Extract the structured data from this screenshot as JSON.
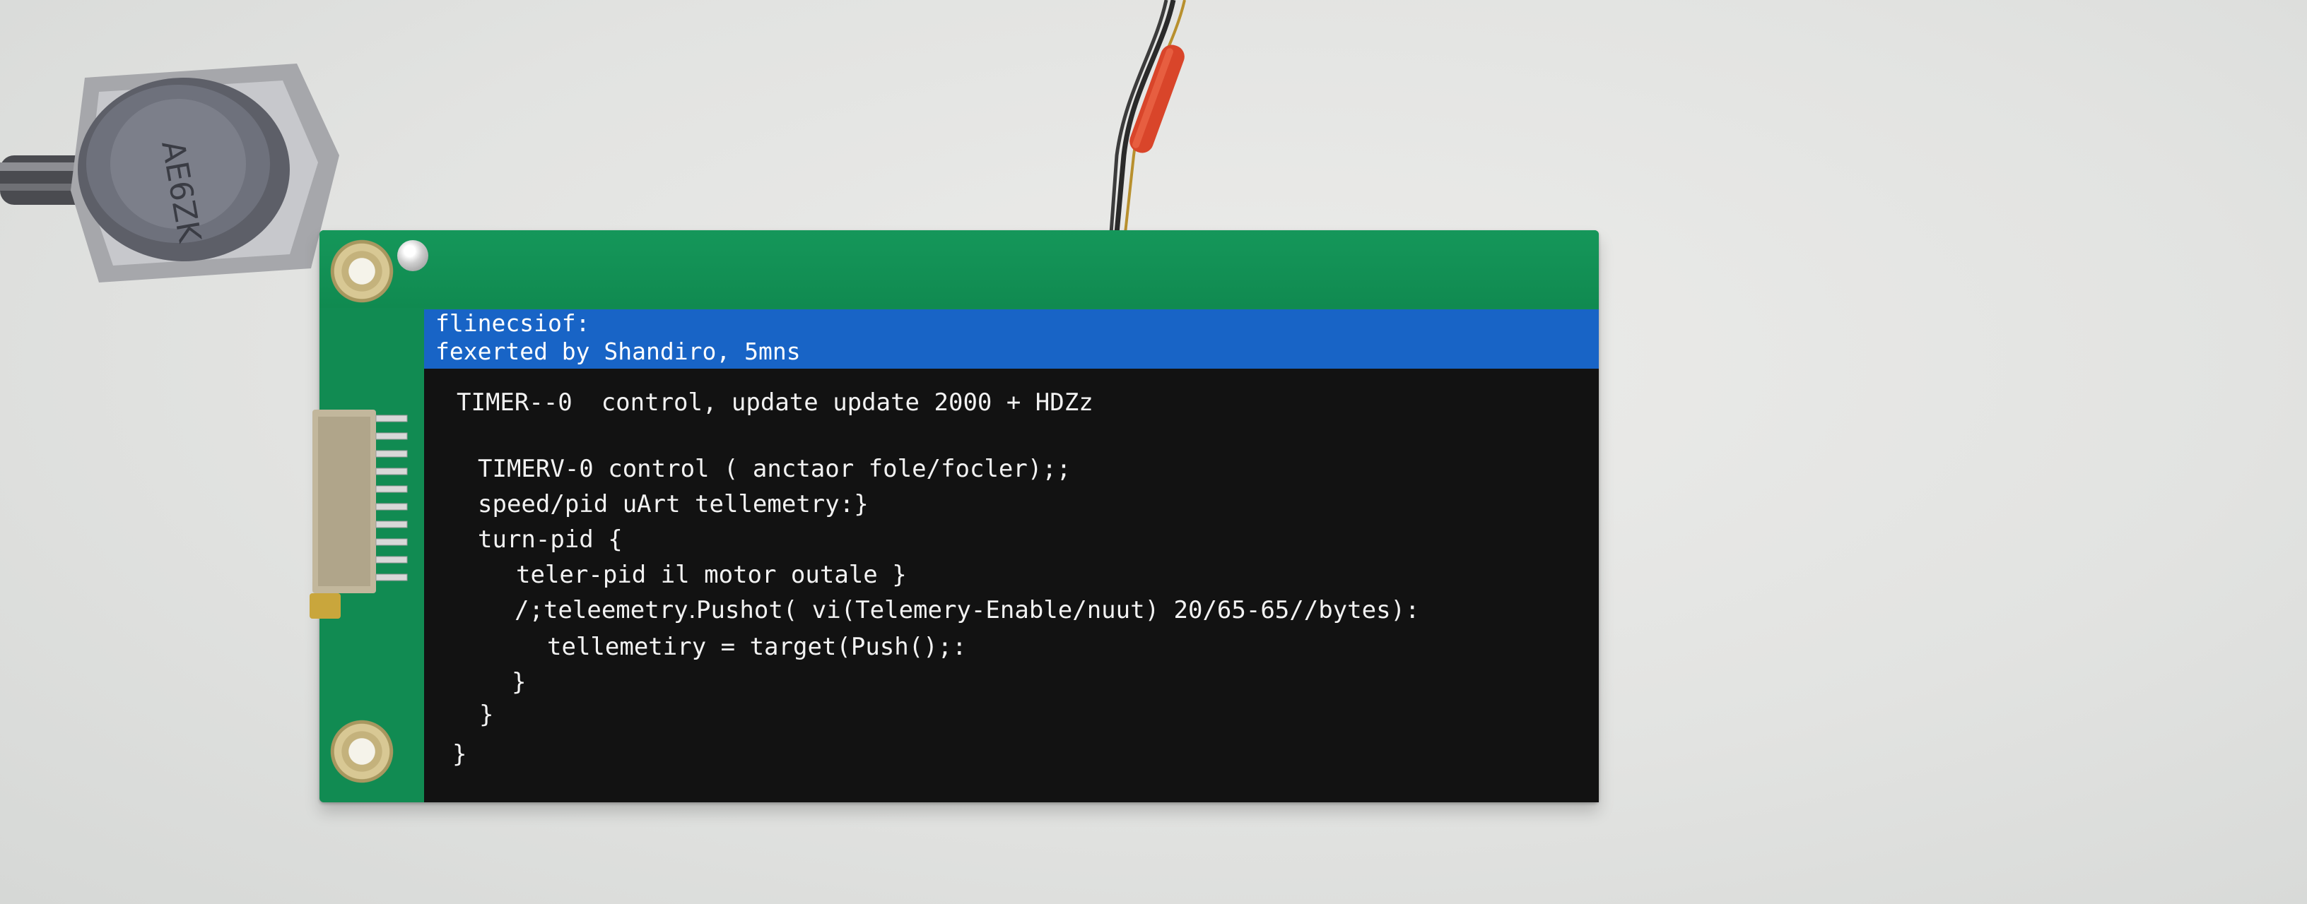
{
  "display": {
    "title_lines": [
      "flinecsiof:",
      "fexerted by Shandiro, 5mns"
    ],
    "code_lines": [
      "TIMER--0  control, update update 2000 + HDZz",
      "TIMERV-0 control ( anctaor fole/focler);;",
      "speed/pid uArt tellemetry:}",
      "turn-pid {",
      "teler-pid il motor outale }",
      "/;teleemetry․Pushot( vi(Telemery-Enable/nuut) 20/65-65//bytes):",
      "tellemetiry = target(Push();:",
      "}",
      "}",
      "}"
    ]
  },
  "connector": {
    "label": "AE6ZK"
  },
  "colors": {
    "pcb_green": "#118b52",
    "titlebar_blue": "#1864c6",
    "screen_black": "#121212",
    "heatshrink_red": "#d9452a"
  }
}
